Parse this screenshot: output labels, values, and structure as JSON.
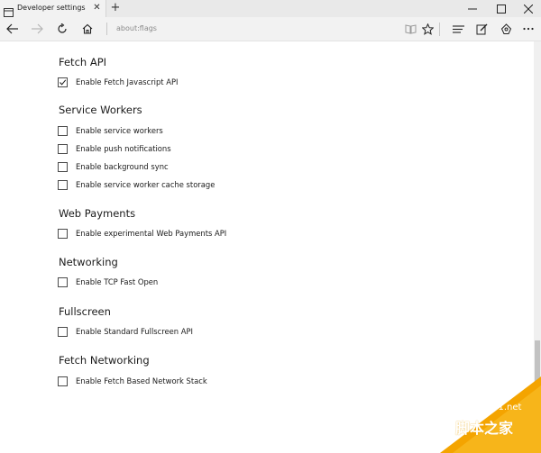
{
  "window": {
    "tab_title": "Developer settings",
    "new_tab_symbol": "+",
    "close_symbol": "✕"
  },
  "navbar": {
    "address": "about:flags"
  },
  "sections": [
    {
      "title": "Fetch API",
      "options": [
        {
          "label": "Enable Fetch Javascript API",
          "checked": true
        }
      ]
    },
    {
      "title": "Service Workers",
      "options": [
        {
          "label": "Enable service workers",
          "checked": false
        },
        {
          "label": "Enable push notifications",
          "checked": false
        },
        {
          "label": "Enable background sync",
          "checked": false
        },
        {
          "label": "Enable service worker cache storage",
          "checked": false
        }
      ]
    },
    {
      "title": "Web Payments",
      "options": [
        {
          "label": "Enable experimental Web Payments API",
          "checked": false
        }
      ]
    },
    {
      "title": "Networking",
      "options": [
        {
          "label": "Enable TCP Fast Open",
          "checked": false
        }
      ]
    },
    {
      "title": "Fullscreen",
      "options": [
        {
          "label": "Enable Standard Fullscreen API",
          "checked": false
        }
      ]
    },
    {
      "title": "Fetch Networking",
      "options": [
        {
          "label": "Enable Fetch Based Network Stack",
          "checked": false
        }
      ]
    }
  ],
  "watermark": {
    "site": "jb51.net",
    "text": "脚本之家"
  },
  "colors": {
    "watermark_orange": "#f4a400",
    "checkbox_border": "#4a4a4a"
  }
}
